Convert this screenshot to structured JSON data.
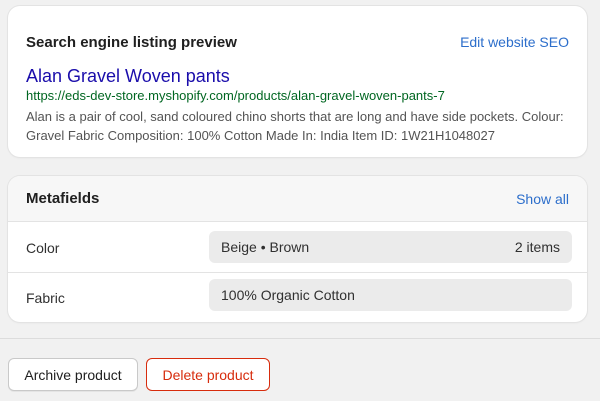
{
  "seo": {
    "heading": "Search engine listing preview",
    "edit_link": "Edit website SEO",
    "page_title": "Alan Gravel Woven pants",
    "url": "https://eds-dev-store.myshopify.com/products/alan-gravel-woven-pants-7",
    "description": "Alan is a pair of cool, sand coloured chino shorts that are long and have side pockets. Colour: Gravel Fabric Composition: 100% Cotton Made In: India Item ID: 1W21H1048027"
  },
  "metafields": {
    "heading": "Metafields",
    "show_all": "Show all",
    "rows": [
      {
        "label": "Color",
        "value": "Beige • Brown",
        "count": "2 items"
      },
      {
        "label": "Fabric",
        "value": "100% Organic Cotton"
      }
    ]
  },
  "actions": {
    "archive": "Archive product",
    "delete": "Delete product"
  },
  "colors": {
    "link": "#2c6ecb",
    "seo_title": "#1a0dab",
    "seo_url": "#006621",
    "danger": "#d72c0d"
  }
}
